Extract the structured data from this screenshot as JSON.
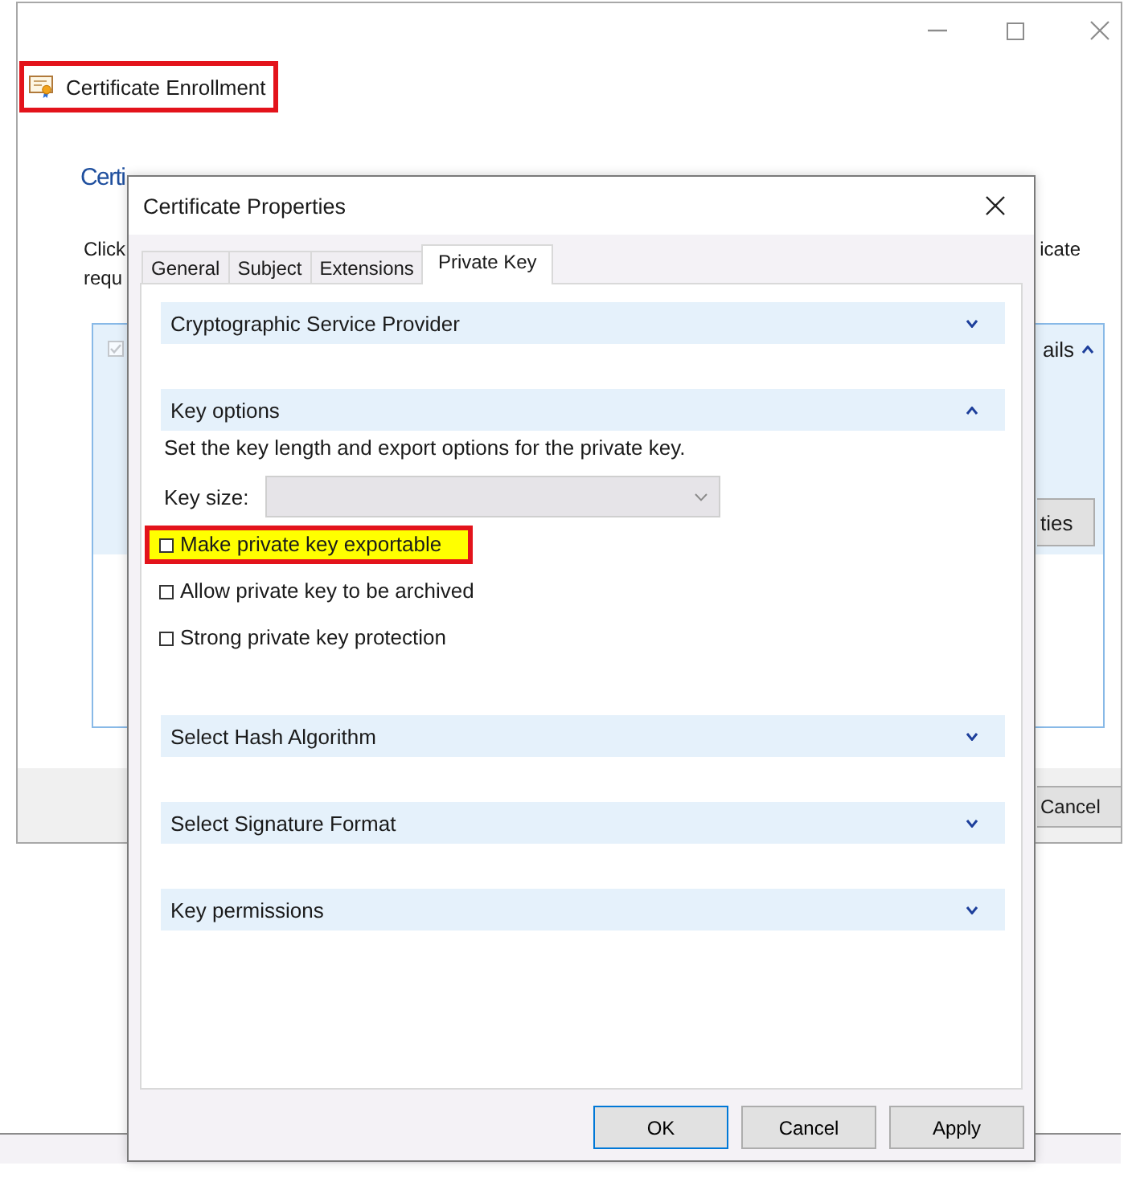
{
  "window": {
    "title": "Certificate Enrollment",
    "title_highlighted": true,
    "heading": "Certi",
    "intro_left": [
      "Click",
      "requ"
    ],
    "intro_right": "icate",
    "panel": {
      "checked": true,
      "details": "ails",
      "details_expanded": true,
      "button": "ties"
    },
    "buttons": [
      "Cancel"
    ]
  },
  "dialog": {
    "title": "Certificate Properties",
    "tabs": [
      {
        "label": "General",
        "selected": false
      },
      {
        "label": "Subject",
        "selected": false
      },
      {
        "label": "Extensions",
        "selected": false
      },
      {
        "label": "Private Key",
        "selected": true
      }
    ],
    "sections": [
      {
        "title": "Cryptographic Service Provider",
        "expanded": false
      },
      {
        "title": "Key options",
        "expanded": true,
        "description": "Set the key length and export options for the private key.",
        "key_size": {
          "label": "Key size:",
          "disabled": true
        },
        "options": [
          {
            "label": "Make private key exportable",
            "checked": false,
            "highlighted": true
          },
          {
            "label": "Allow private key to be archived",
            "checked": false,
            "highlighted": false
          },
          {
            "label": "Strong private key protection",
            "checked": false,
            "highlighted": false
          }
        ]
      },
      {
        "title": "Select Hash Algorithm",
        "expanded": false
      },
      {
        "title": "Select Signature Format",
        "expanded": false
      },
      {
        "title": "Key permissions",
        "expanded": false
      }
    ],
    "buttons": [
      {
        "label": "OK",
        "default": true
      },
      {
        "label": "Cancel",
        "default": false
      },
      {
        "label": "Apply",
        "default": false
      }
    ]
  }
}
